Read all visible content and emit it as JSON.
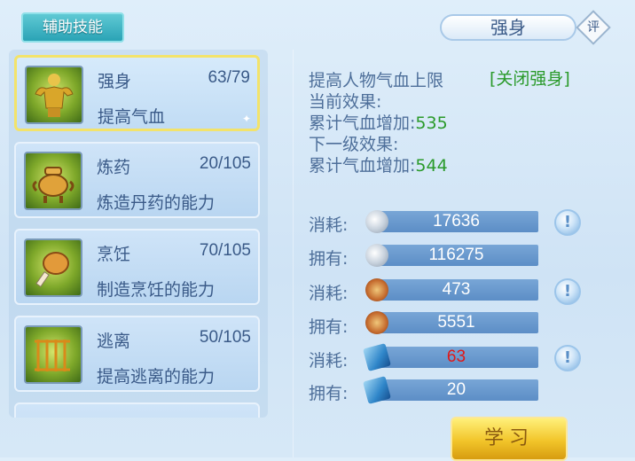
{
  "tab": {
    "label": "辅助技能"
  },
  "skills": [
    {
      "name": "强身",
      "level": "63/79",
      "desc": "提高气血"
    },
    {
      "name": "炼药",
      "level": "20/105",
      "desc": "炼造丹药的能力"
    },
    {
      "name": "烹饪",
      "level": "70/105",
      "desc": "制造烹饪的能力"
    },
    {
      "name": "逃离",
      "level": "50/105",
      "desc": "提高逃离的能力"
    }
  ],
  "detail": {
    "title": "强身",
    "rate_label": "评",
    "effect_desc": "提高人物气血上限",
    "close_label": "[关闭强身]",
    "current_label": "当前效果:",
    "current_stat_label": "累计气血增加:",
    "current_value": "535",
    "next_label": "下一级效果:",
    "next_stat_label": "累计气血增加:",
    "next_value": "544"
  },
  "resources": [
    {
      "label": "消耗:",
      "icon": "silver-coin-icon",
      "value": "17636",
      "hint": true
    },
    {
      "label": "拥有:",
      "icon": "silver-coin-icon",
      "value": "116275",
      "hint": false
    },
    {
      "label": "消耗:",
      "icon": "contribution-icon",
      "value": "473",
      "hint": true
    },
    {
      "label": "拥有:",
      "icon": "contribution-icon",
      "value": "5551",
      "hint": false
    },
    {
      "label": "消耗:",
      "icon": "skill-book-icon",
      "value": "63",
      "hint": true,
      "insufficient": true
    },
    {
      "label": "拥有:",
      "icon": "skill-book-icon",
      "value": "20",
      "hint": false
    }
  ],
  "hint_symbol": "!",
  "learn_button": "学习",
  "colors": {
    "text": "#4e6f9a",
    "green": "#2a9a2a",
    "red": "#e01818",
    "gold": "#f2c52a"
  }
}
